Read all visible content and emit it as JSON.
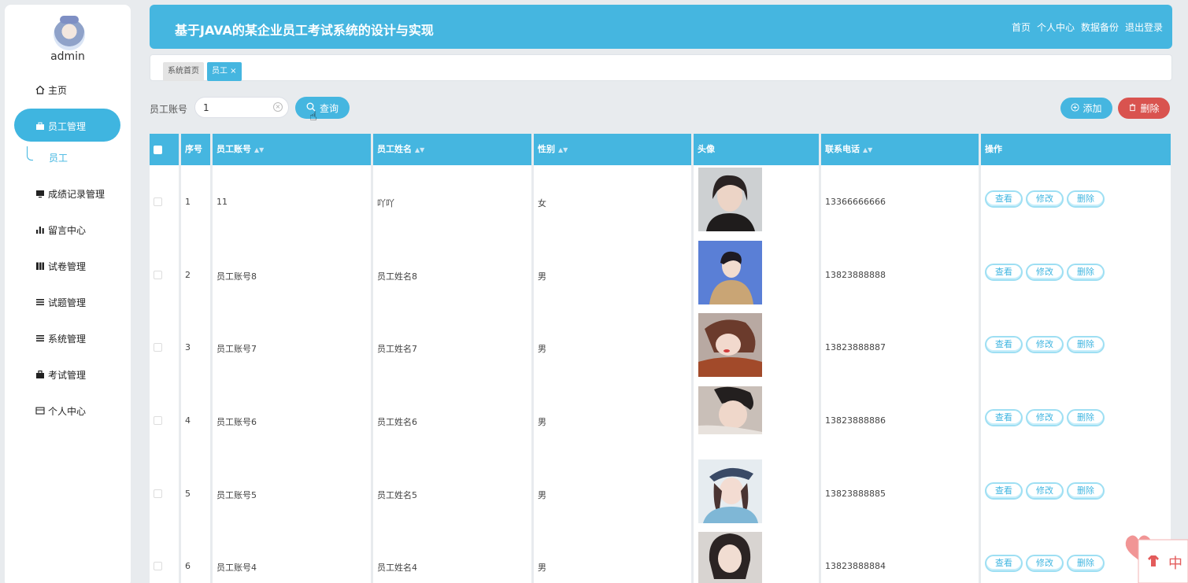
{
  "sidebar": {
    "username": "admin",
    "menu": [
      {
        "label": "主页",
        "icon": "home-icon"
      },
      {
        "label": "员工管理",
        "icon": "briefcase-icon"
      },
      {
        "label": "成绩记录管理",
        "icon": "monitor-icon"
      },
      {
        "label": "留言中心",
        "icon": "bar-chart-icon"
      },
      {
        "label": "试卷管理",
        "icon": "book-icon"
      },
      {
        "label": "试题管理",
        "icon": "list-icon"
      },
      {
        "label": "系统管理",
        "icon": "list-icon"
      },
      {
        "label": "考试管理",
        "icon": "toolbox-icon"
      },
      {
        "label": "个人中心",
        "icon": "card-icon"
      }
    ],
    "submenu": [
      "员工"
    ]
  },
  "header": {
    "title": "基于JAVA的某企业员工考试系统的设计与实现",
    "links": [
      "首页",
      "个人中心",
      "数据备份",
      "退出登录"
    ]
  },
  "tabs": [
    "系统首页",
    "员工 ×"
  ],
  "search": {
    "label": "员工账号",
    "value": "1",
    "button": "查询"
  },
  "actions": {
    "add": "添加",
    "delete": "删除"
  },
  "table": {
    "headers": [
      "序号",
      "员工账号",
      "员工姓名",
      "性别",
      "头像",
      "联系电话",
      "操作"
    ],
    "ops": [
      "查看",
      "修改",
      "删除"
    ],
    "rows": [
      {
        "no": "1",
        "account": "11",
        "name": "吖吖",
        "gender": "女",
        "phone": "13366666666"
      },
      {
        "no": "2",
        "account": "员工账号8",
        "name": "员工姓名8",
        "gender": "男",
        "phone": "13823888888"
      },
      {
        "no": "3",
        "account": "员工账号7",
        "name": "员工姓名7",
        "gender": "男",
        "phone": "13823888887"
      },
      {
        "no": "4",
        "account": "员工账号6",
        "name": "员工姓名6",
        "gender": "男",
        "phone": "13823888886"
      },
      {
        "no": "5",
        "account": "员工账号5",
        "name": "员工姓名5",
        "gender": "男",
        "phone": "13823888885"
      },
      {
        "no": "6",
        "account": "员工账号4",
        "name": "员工姓名4",
        "gender": "男",
        "phone": "13823888884"
      }
    ]
  },
  "decoration": {
    "text": "中"
  },
  "colors": {
    "primary": "#45b6e0",
    "danger": "#d9534f"
  }
}
